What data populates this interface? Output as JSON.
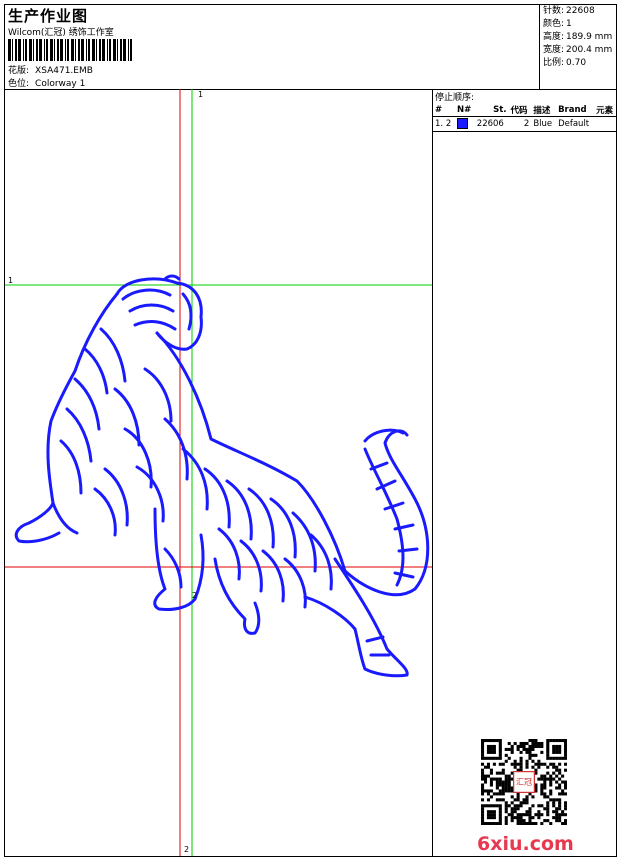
{
  "header": {
    "title": "生产作业图",
    "company": "Wilcom(汇冠) 绣饰工作室",
    "design_label": "花版:",
    "design_value": "XSA471.EMB",
    "colorway_label": "色位:",
    "colorway_value": "Colorway 1"
  },
  "stats": [
    {
      "label": "针数:",
      "value": "22608"
    },
    {
      "label": "颜色:",
      "value": "1"
    },
    {
      "label": "高度:",
      "value": "189.9 mm"
    },
    {
      "label": "宽度:",
      "value": "200.4 mm"
    },
    {
      "label": "比例:",
      "value": "0.70"
    }
  ],
  "stop_sequence": {
    "title": "停止顺序:",
    "columns": [
      "#",
      "N#",
      "St.",
      "代码",
      "描述",
      "Brand",
      "元素"
    ],
    "rows": [
      {
        "index": "1.",
        "needle": "2",
        "stitches": "22606",
        "code": "2",
        "description": "Blue",
        "brand": "Default",
        "color": "#1a1aff"
      }
    ]
  },
  "canvas": {
    "axis_labels": [
      "1",
      "1",
      "2",
      "2"
    ],
    "thread_color": "#1a1aff",
    "guide_green": "#00cc00",
    "guide_red": "#e00000"
  },
  "watermark": "6xiu.com",
  "stamp_text": "汇冠"
}
